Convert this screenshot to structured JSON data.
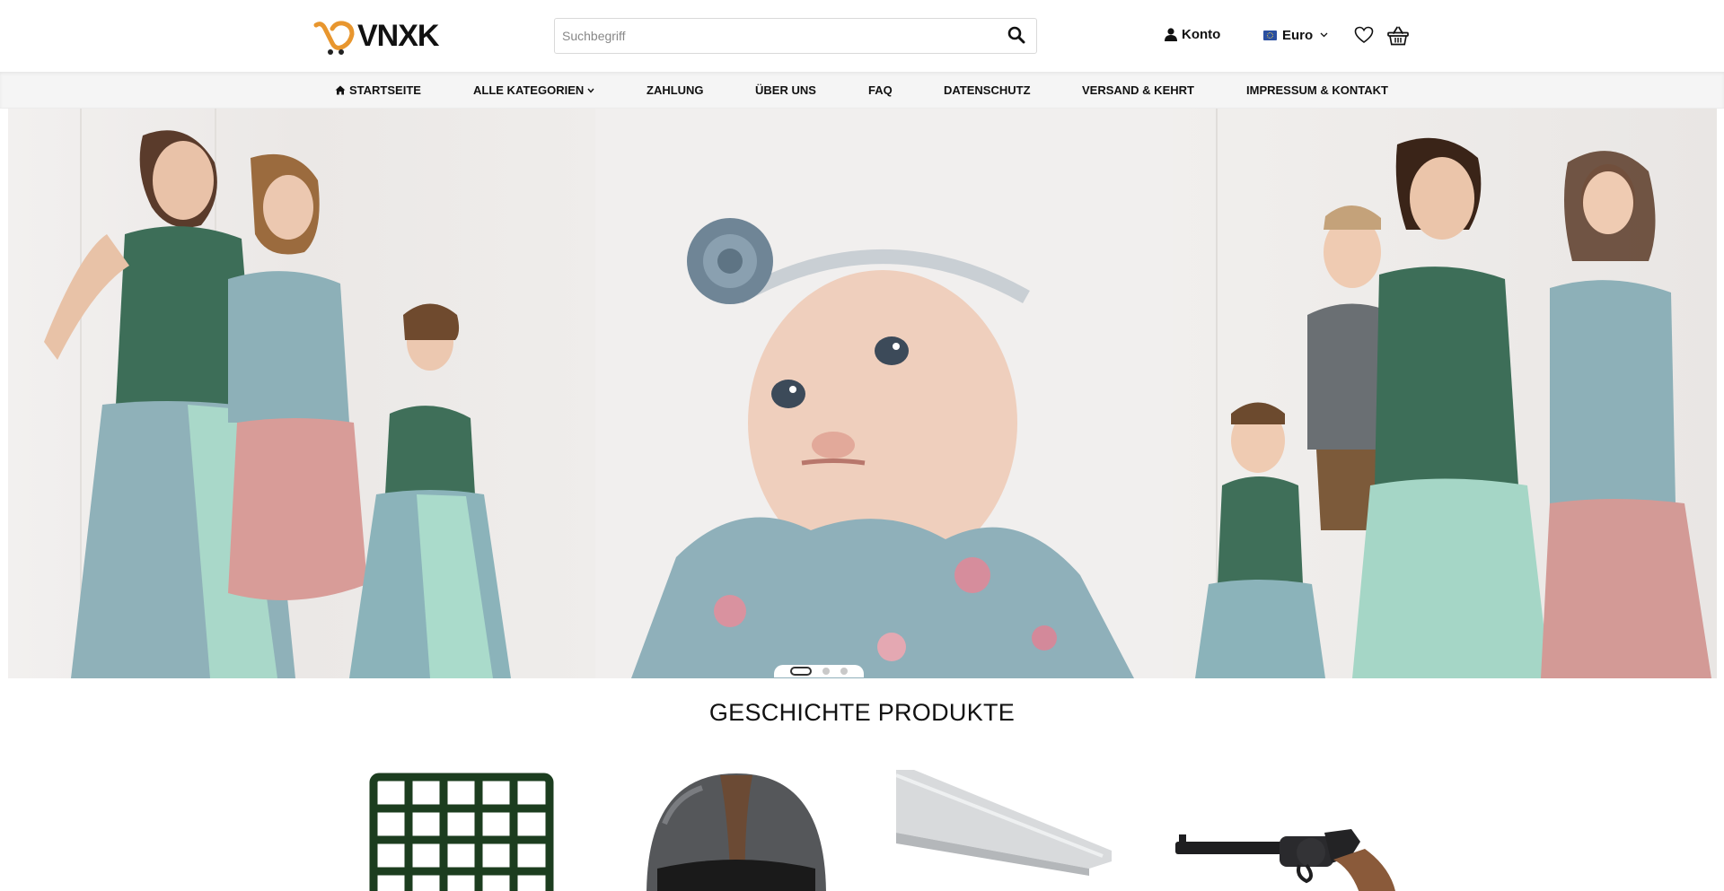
{
  "brand": {
    "name": "VNXK",
    "colors": {
      "accent": "#e8962e",
      "text": "#111111"
    }
  },
  "search": {
    "placeholder": "Suchbegriff",
    "value": "",
    "icon": "search-icon"
  },
  "header": {
    "account_label": "Konto",
    "currency_label": "Euro",
    "icons": [
      "user-icon",
      "flag-eu-icon",
      "chevron-down-icon",
      "heart-icon",
      "basket-icon"
    ]
  },
  "nav": {
    "items": [
      {
        "label": "STARTSEITE",
        "icon": "home-icon"
      },
      {
        "label": "ALLE KATEGORIEN",
        "icon": "chevron-down-icon"
      },
      {
        "label": "ZAHLUNG"
      },
      {
        "label": "ÜBER UNS"
      },
      {
        "label": "FAQ"
      },
      {
        "label": "DATENSCHUTZ"
      },
      {
        "label": "VERSAND & KEHRT"
      },
      {
        "label": "IMPRESSUM & KONTAKT"
      }
    ]
  },
  "slider": {
    "slides": 3,
    "active_slide": 1,
    "panels": [
      "mother-and-daughters-in-dirndl-photo",
      "baby-in-floral-dress-photo",
      "family-in-dirndl-photo"
    ]
  },
  "featured": {
    "title": "GESCHICHTE PRODUKTE",
    "products": [
      {
        "image": "green-grid-mat-photo"
      },
      {
        "image": "motorcycle-helmet-photo"
      },
      {
        "image": "aluminium-profile-photo"
      },
      {
        "image": "revolver-photo"
      }
    ]
  }
}
